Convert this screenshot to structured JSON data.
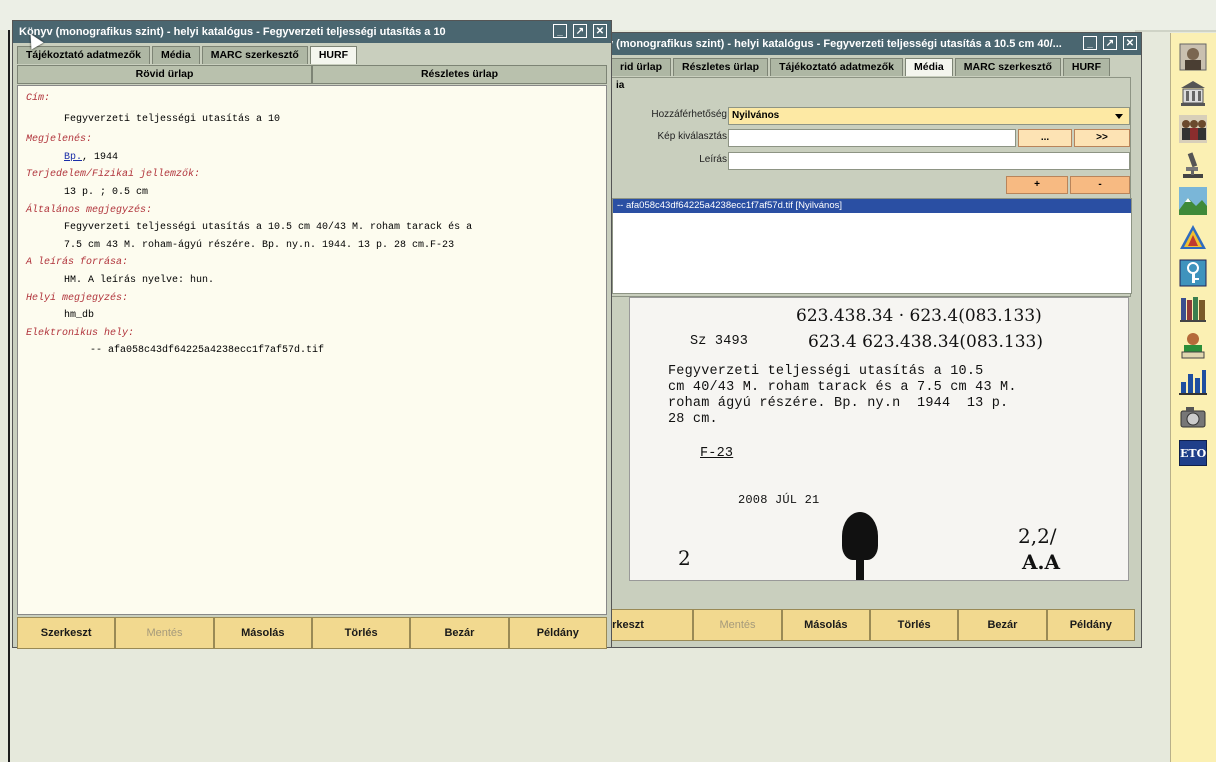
{
  "back_window": {
    "title": "v (monografikus szint) - helyi katalógus - Fegyverzeti teljességi utasítás a 10.5 cm 40/...",
    "tabs": [
      "rid ürlap",
      "Részletes ürlap",
      "Tájékoztató adatmezők",
      "Média",
      "MARC szerkesztő",
      "HURF"
    ],
    "section_label": "ia",
    "access_label": "Hozzáférhetőség",
    "access_value": "Nyilvános",
    "image_select_label": "Kép kiválasztás",
    "image_btn1": "...",
    "image_btn2": ">>",
    "description_label": "Leírás",
    "add_btn": "+",
    "remove_btn": "-",
    "file_entry": "-- afa058c43df64225a4238ecc1f7af57d.tif [Nyilvános]",
    "buttons": [
      "erkeszt",
      "Mentés",
      "Másolás",
      "Törlés",
      "Bezár",
      "Példány"
    ],
    "scan_card": {
      "hand_line1": "623.438.34 · 623.4(083.133)",
      "hand_line2": "623.4 623.438.34(083.133)",
      "sig": "Sz 3493",
      "typed": "Fegyverzeti teljességi utasítás a 10.5\ncm 40/43 M. roham tarack és a 7.5 cm 43 M.\nroham ágyú részére. Bp. ny.n  1944  13 p.\n28 cm.",
      "code": "F-23",
      "stamp": "2008 JÚL 21",
      "num_left": "2",
      "num_right": "2,2/",
      "initials": "A.A"
    }
  },
  "front_window": {
    "title": "Könyv (monografikus szint) - helyi katalógus - Fegyverzeti teljességi utasítás a 10",
    "tabs": [
      "Tájékoztató adatmezők",
      "Média",
      "MARC szerkesztő",
      "HURF"
    ],
    "subtabs": [
      "Rövid ürlap",
      "Részletes ürlap"
    ],
    "record": {
      "cim_label": "Cím:",
      "cim_value": "Fegyverzeti teljességi utasítás a 10",
      "megjelenes_label": "Megjelenés:",
      "megjelenes_link": "Bp.",
      "megjelenes_rest": ", 1944",
      "terjedelem_label": "Terjedelem/Fizikai jellemzők:",
      "terjedelem_value": "13 p. ; 0.5 cm",
      "altalanos_label": "Általános megjegyzés:",
      "altalanos_value1": "Fegyverzeti teljességi utasítás a 10.5 cm 40/43 M. roham tarack és a",
      "altalanos_value2": "7.5 cm 43 M. roham-ágyú részére. Bp. ny.n. 1944. 13 p. 28 cm.F-23",
      "forras_label": "A leírás forrása:",
      "forras_value": "HM. A leírás nyelve: hun.",
      "helyi_label": "Helyi megjegyzés:",
      "helyi_value": "hm_db",
      "elektronikus_label": "Elektronikus hely:",
      "elektronikus_value": "-- afa058c43df64225a4238ecc1f7af57d.tif"
    },
    "buttons": [
      "Szerkeszt",
      "Mentés",
      "Másolás",
      "Törlés",
      "Bezár",
      "Példány"
    ]
  },
  "right_toolbar": {
    "icons": [
      "portrait-icon",
      "building-icon",
      "people-icon",
      "microscope-icon",
      "landscape-icon",
      "map-icon",
      "key-icon",
      "books-icon",
      "reader-icon",
      "chart-icon",
      "camera-icon",
      "eto-icon"
    ],
    "eto_label": "ETO"
  },
  "colors": {
    "titlebar": "#4a6670",
    "button": "#f2d98f",
    "accent_orange": "#f7ba82",
    "selection": "#2a4fa3",
    "record_bg": "#fdfcef"
  }
}
